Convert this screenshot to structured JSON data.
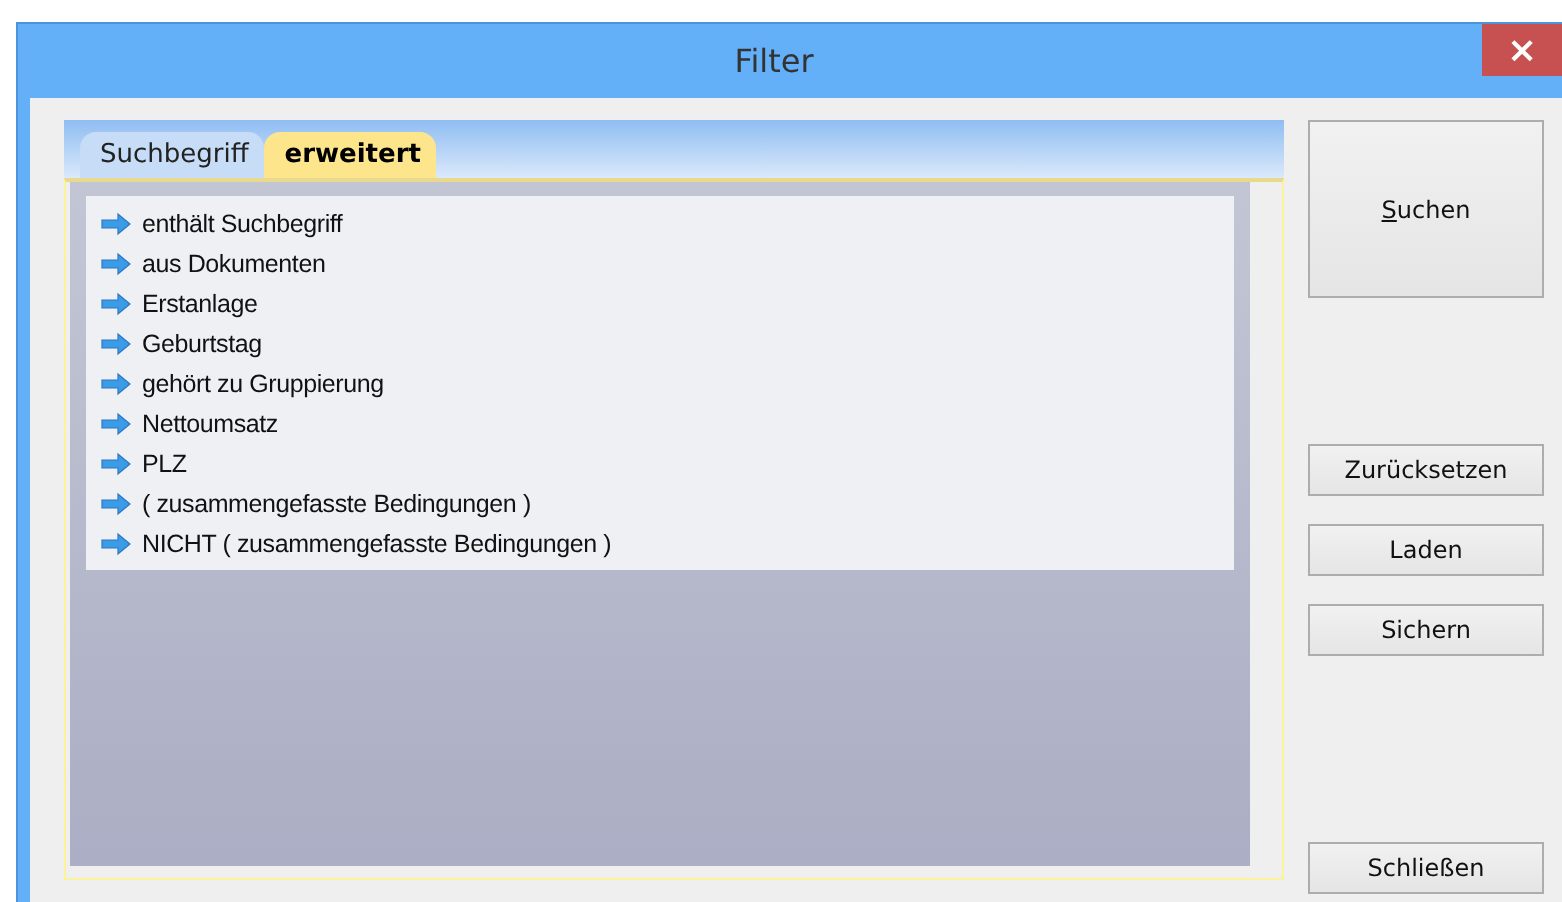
{
  "window": {
    "title": "Filter",
    "close": "×"
  },
  "tabs": [
    {
      "label": "Suchbegriff",
      "selected": false
    },
    {
      "label": "erweitert",
      "selected": true
    }
  ],
  "conditions": [
    "enthält Suchbegriff",
    "aus Dokumenten",
    "Erstanlage",
    "Geburtstag",
    "gehört zu Gruppierung",
    "Nettoumsatz",
    "PLZ",
    "( zusammengefasste Bedingungen )",
    "NICHT ( zusammengefasste Bedingungen )"
  ],
  "buttons": [
    {
      "label": "Suchen",
      "kind": "primary",
      "underlined_first_letter": true
    },
    {
      "label": "Zurücksetzen",
      "kind": "normal"
    },
    {
      "label": "Laden",
      "kind": "normal"
    },
    {
      "label": "Sichern",
      "kind": "normal"
    },
    {
      "label": "Schließen",
      "kind": "close"
    }
  ]
}
